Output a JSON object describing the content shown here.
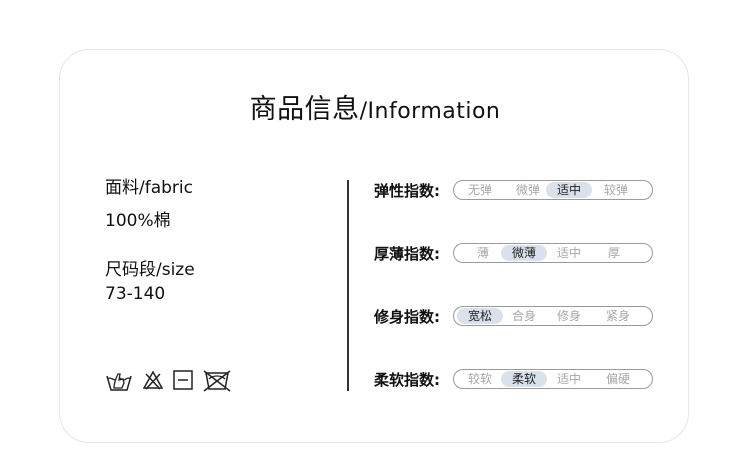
{
  "title": {
    "cn": "商品信息",
    "slash": "/",
    "en": "Information"
  },
  "fabric": {
    "label_cn": "面料",
    "label_en": "/fabric",
    "value": "100%棉"
  },
  "size": {
    "label_cn": "尺码段",
    "label_en": "/size",
    "value": "73-140"
  },
  "care_icons": [
    "hand-wash-icon",
    "no-bleach-icon",
    "dry-flat-icon",
    "no-tumble-dry-icon"
  ],
  "attributes": [
    {
      "label": "弹性指数:",
      "options": [
        "无弹",
        "微弹",
        "适中",
        "较弹"
      ],
      "selected_index": 2
    },
    {
      "label": "厚薄指数:",
      "options": [
        "薄",
        "微薄",
        "适中",
        "厚"
      ],
      "selected_index": 1
    },
    {
      "label": "修身指数:",
      "options": [
        "宽松",
        "合身",
        "修身",
        "紧身"
      ],
      "selected_index": 0
    },
    {
      "label": "柔软指数:",
      "options": [
        "较软",
        "柔软",
        "适中",
        "偏硬"
      ],
      "selected_index": 1
    }
  ],
  "colors": {
    "selected_bg": "#d9e1ec",
    "unselected_text": "#a7a7a7",
    "border": "#e6e6e6"
  }
}
